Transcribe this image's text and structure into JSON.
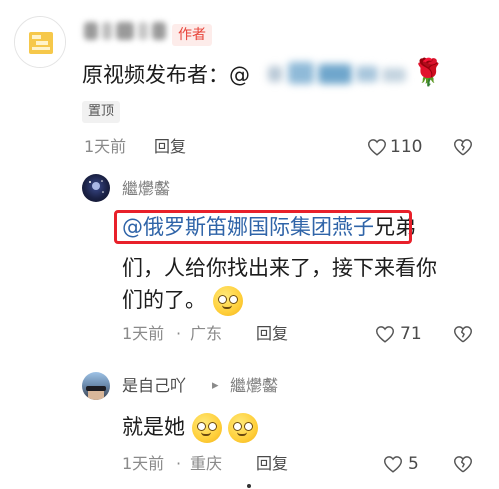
{
  "comment": {
    "author_tag": "作者",
    "text_prefix": "原视频发布者：@",
    "rose_emoji": "🌹",
    "pinned_label": "置顶",
    "time": "1天前",
    "reply_label": "回复",
    "like_count": "110"
  },
  "reply1": {
    "username": "繼爩齾",
    "mention": "@俄罗斯笛娜国际集团燕子",
    "text_line1_suffix": "兄弟",
    "text_line2": "们，人给你找出来了，接下来看你",
    "text_line3": "们的了。",
    "time": "1天前",
    "separator": "·",
    "location": "广东",
    "reply_label": "回复",
    "like_count": "71"
  },
  "reply2": {
    "username": "是自己吖",
    "reply_arrow": "▸",
    "reply_to": "繼爩齾",
    "text": "就是她",
    "time": "1天前",
    "separator": "·",
    "location": "重庆",
    "reply_label": "回复",
    "like_count": "5"
  },
  "colors": {
    "author_tag_bg": "#fdecea",
    "author_tag_text": "#e8443a",
    "mention": "#2f64a8",
    "highlight_box": "#e8202a"
  }
}
